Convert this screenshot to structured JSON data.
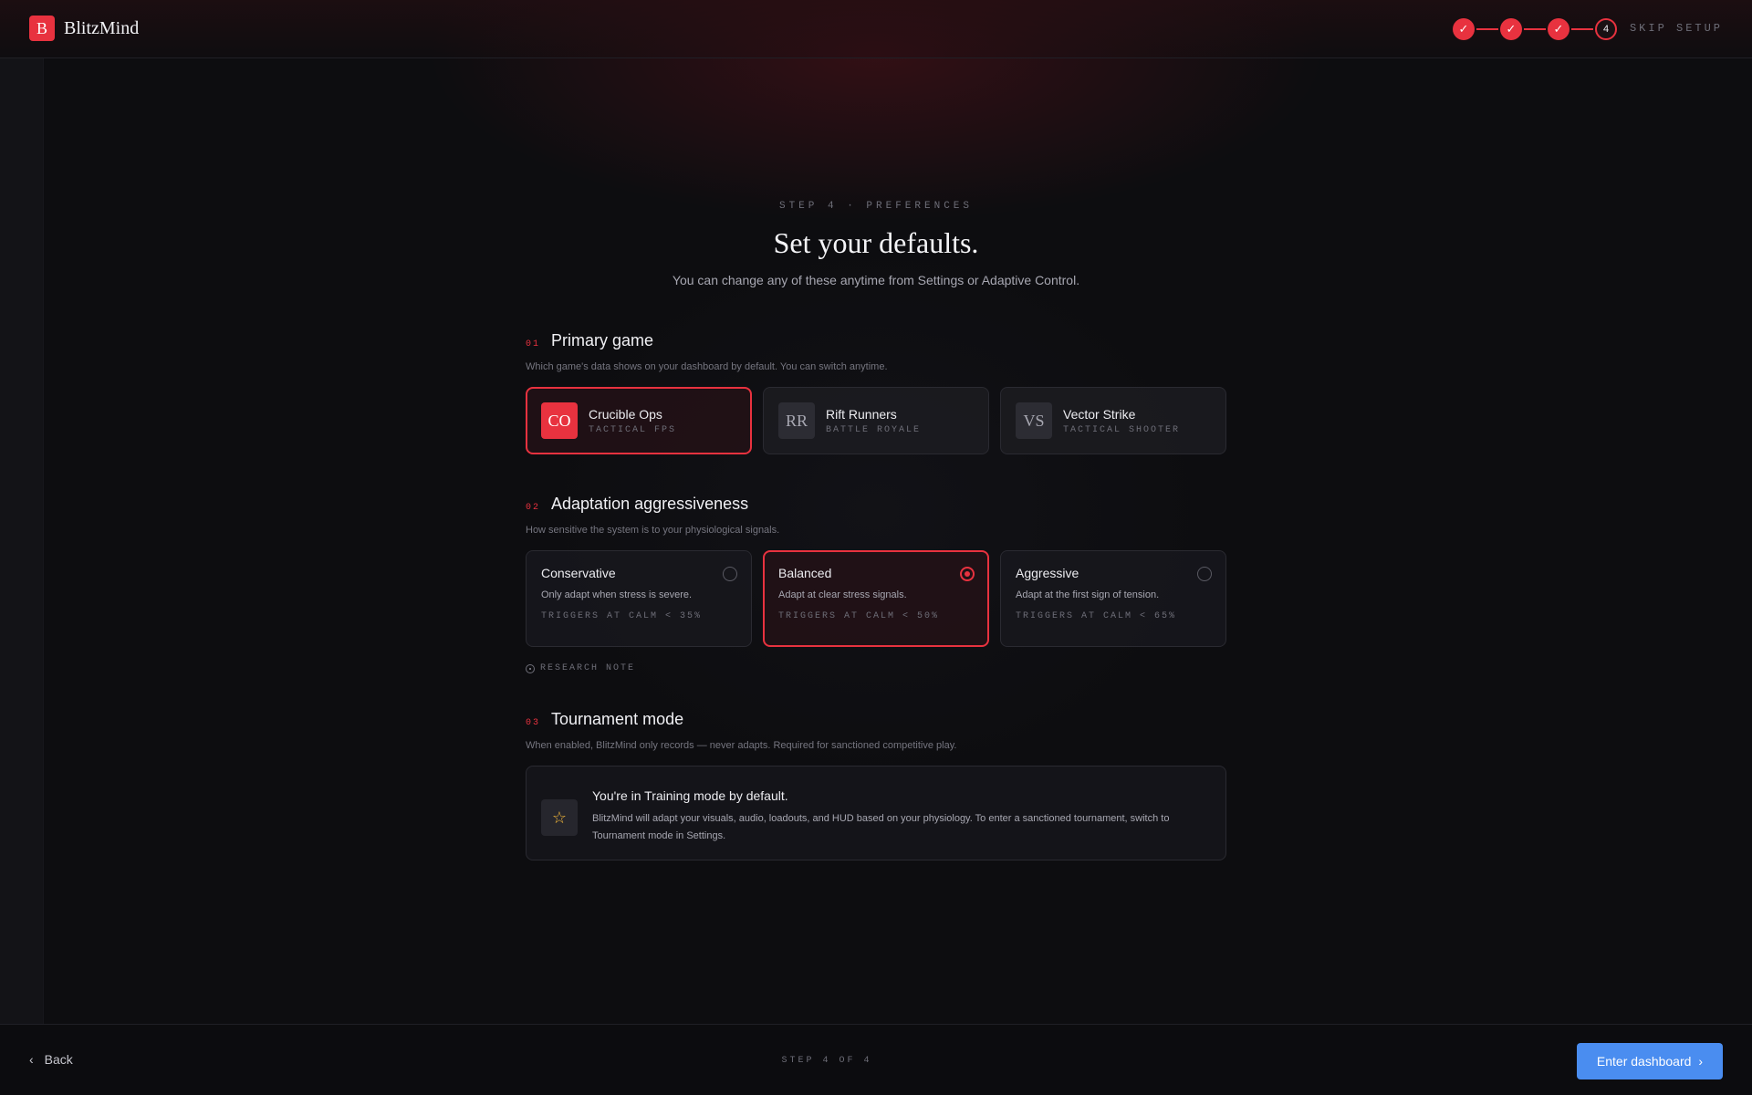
{
  "header": {
    "logo_letter": "B",
    "app_name": "BlitzMind",
    "steps": [
      "✓",
      "✓",
      "✓",
      "4"
    ],
    "skip_label": "SKIP SETUP"
  },
  "intro": {
    "eyebrow": "STEP 4 · PREFERENCES",
    "title": "Set your defaults.",
    "subtitle": "You can change any of these anytime from Settings or Adaptive Control."
  },
  "primary_game": {
    "number": "01",
    "title": "Primary game",
    "description": "Which game's data shows on your dashboard by default. You can switch anytime.",
    "games": [
      {
        "badge": "CO",
        "name": "Crucible Ops",
        "genre": "TACTICAL FPS",
        "selected": true
      },
      {
        "badge": "RR",
        "name": "Rift Runners",
        "genre": "BATTLE ROYALE",
        "selected": false
      },
      {
        "badge": "VS",
        "name": "Vector Strike",
        "genre": "TACTICAL SHOOTER",
        "selected": false
      }
    ]
  },
  "aggressiveness": {
    "number": "02",
    "title": "Adaptation aggressiveness",
    "description": "How sensitive the system is to your physiological signals.",
    "options": [
      {
        "name": "Conservative",
        "desc": "Only adapt when stress is severe.",
        "trigger": "TRIGGERS AT CALM < 35%",
        "selected": false
      },
      {
        "name": "Balanced",
        "desc": "Adapt at clear stress signals.",
        "trigger": "TRIGGERS AT CALM < 50%",
        "selected": true
      },
      {
        "name": "Aggressive",
        "desc": "Adapt at the first sign of tension.",
        "trigger": "TRIGGERS AT CALM < 65%",
        "selected": false
      }
    ],
    "research_note": "RESEARCH NOTE"
  },
  "tournament": {
    "number": "03",
    "title": "Tournament mode",
    "description": "When enabled, BlitzMind only records — never adapts. Required for sanctioned competitive play.",
    "box_title": "You're in Training mode by default.",
    "box_desc": "BlitzMind will adapt your visuals, audio, loadouts, and HUD based on your physiology. To enter a sanctioned tournament, switch to Tournament mode in Settings."
  },
  "footer": {
    "back_label": "Back",
    "step_label": "STEP 4 OF 4",
    "enter_label": "Enter dashboard"
  },
  "colors": {
    "accent": "#e8323f",
    "primary_button": "#4a8df0",
    "star": "#f2b73a"
  }
}
